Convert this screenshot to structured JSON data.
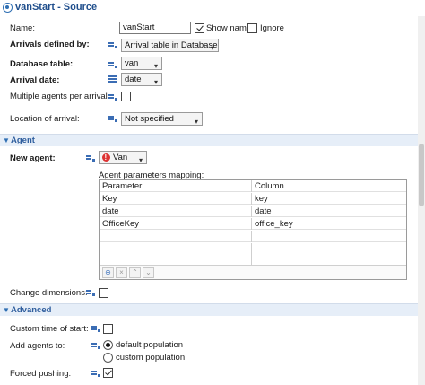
{
  "window": {
    "title": "vanStart - Source"
  },
  "fields": {
    "name_label": "Name:",
    "name_value": "vanStart",
    "show_name_label": "Show name",
    "ignore_label": "Ignore",
    "arrivals_label": "Arrivals defined by:",
    "arrivals_value": "Arrival table in Database",
    "db_table_label": "Database table:",
    "db_table_value": "van",
    "arrival_date_label": "Arrival date:",
    "arrival_date_value": "date",
    "multiple_agents_label": "Multiple agents per arrival:",
    "location_label": "Location of arrival:",
    "location_value": "Not specified"
  },
  "agent_section": {
    "title": "Agent",
    "new_agent_label": "New agent:",
    "new_agent_value": "Van",
    "mapping_label": "Agent parameters mapping:",
    "columns": [
      "Parameter",
      "Column"
    ],
    "rows": [
      [
        "Key",
        "key"
      ],
      [
        "date",
        "date"
      ],
      [
        "OfficeKey",
        "office_key"
      ]
    ],
    "change_dimensions_label": "Change dimensions:"
  },
  "advanced_section": {
    "title": "Advanced",
    "custom_time_label": "Custom time of start:",
    "add_agents_label": "Add agents to:",
    "option_default": "default population",
    "option_custom": "custom population",
    "forced_pushing_label": "Forced pushing:"
  },
  "state": {
    "show_name": true,
    "ignore": false,
    "multiple_agents": false,
    "change_dimensions": false,
    "custom_time": false,
    "add_agents_to": "default population",
    "forced_pushing": true
  },
  "icons": {
    "title": "source-block-icon",
    "dynamic_value": "dynamic-value-icon",
    "database": "database-table-icon",
    "agent": "agent-type-icon"
  },
  "colors": {
    "title": "#1f4e8c",
    "section_bar": "#e6eef8",
    "section_title": "#2f5e9e",
    "agent_icon": "#dd3333"
  }
}
